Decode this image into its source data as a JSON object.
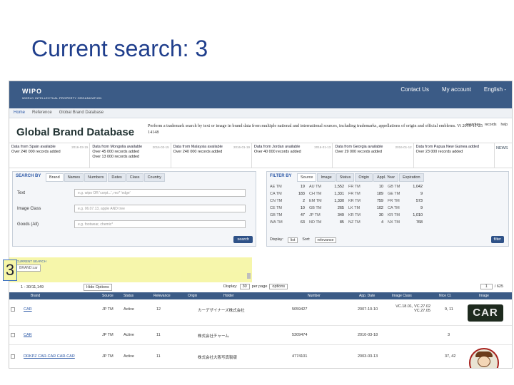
{
  "slide": {
    "title": "Current search: 3",
    "marker": "3"
  },
  "header": {
    "logo": "WIPO",
    "logo_sub": "WORLD INTELLECTUAL PROPERTY ORGANIZATION",
    "nav": [
      "Contact Us",
      "My account",
      "English -"
    ]
  },
  "breadcrumb": [
    "Home",
    "Reference",
    "Global Brand Database"
  ],
  "gbd": {
    "title": "Global Brand Database",
    "description": "Perform a trademark search by text or image in brand data from multiple national and international sources, including trademarks, appellations of origin and official emblems. Vi 2016-11-25 14148",
    "options": [
      "searches",
      "records",
      "help"
    ]
  },
  "news": {
    "items": [
      {
        "title": "Data from Spain available",
        "body": "Over 240 000 records added",
        "date": "2016-03-15"
      },
      {
        "title": "Data from Mongolia available",
        "body": "Over 45 000 records added\nOver 13 000 records added",
        "date": "2016-03-15"
      },
      {
        "title": "Data from Malaysia available",
        "body": "Over 240 000 records added",
        "date": "2016-01-19"
      },
      {
        "title": "Data from Jordan available",
        "body": "Over 40 000 records added",
        "date": "2016-01-13"
      },
      {
        "title": "Data from Georgia available",
        "body": "Over 29 000 records added",
        "date": "2016-01-12"
      },
      {
        "title": "Data from Papua New Guinea added",
        "body": "Over 23 000 records added",
        "date": ""
      }
    ],
    "button": "NEWS"
  },
  "search": {
    "title": "SEARCH BY",
    "tabs": [
      "Brand",
      "Names",
      "Numbers",
      "Dates",
      "Class",
      "Country"
    ],
    "rows": [
      {
        "label": "Text",
        "placeholder": "e.g. wipo OR 'corpt...', mo* 'edge'"
      },
      {
        "label": "Image Class",
        "placeholder": "e.g. 06.07.13, apple AND tree"
      },
      {
        "label": "Goods (All)",
        "placeholder": "e.g. footwear, chemic*"
      }
    ],
    "button": "search"
  },
  "filter": {
    "title": "FILTER BY",
    "tabs": [
      "Source",
      "Image",
      "Status",
      "Origin",
      "Appl. Year",
      "Expiration"
    ],
    "rows": [
      [
        [
          "AE TM",
          "19"
        ],
        [
          "AU TM",
          "1,552"
        ],
        [
          "FR TM",
          "10"
        ],
        [
          "GB TM",
          "1,042"
        ]
      ],
      [
        [
          "CA TM",
          "183"
        ],
        [
          "CH TM",
          "1,331"
        ],
        [
          "FR TM",
          "189"
        ],
        [
          "GE TM",
          "9"
        ]
      ],
      [
        [
          "CN TM",
          "2"
        ],
        [
          "EM TM",
          "1,330"
        ],
        [
          "KR TM",
          "759"
        ],
        [
          "FR TM",
          "573"
        ]
      ],
      [
        [
          "CE TM",
          "10"
        ],
        [
          "GB TM",
          "265"
        ],
        [
          "LK TM",
          "102"
        ],
        [
          "CA TM",
          "9"
        ]
      ],
      [
        [
          "GB TM",
          "47"
        ],
        [
          "JP TM",
          "349"
        ],
        [
          "KR TM",
          "30"
        ],
        [
          "KR TM",
          "1,010"
        ]
      ],
      [
        [
          "WA TM",
          "63"
        ],
        [
          "ND TM",
          "85"
        ],
        [
          "NZ TM",
          "4"
        ],
        [
          "NX TM",
          "768"
        ]
      ]
    ],
    "display_label": "Display:",
    "display_value": "list",
    "sort_label": "Sort:",
    "sort_value": "relevance",
    "button": "filter"
  },
  "current": {
    "label": "CURRENT SEARCH",
    "tag": "BRAND:car"
  },
  "results": {
    "count": "1 - 30/11,149",
    "options": "Hide Options",
    "display_label": "Display:",
    "per_page_value": "30",
    "per_page_label": "per page",
    "options2": "options",
    "page": "1",
    "pages": "/ 625",
    "columns": [
      "Brand",
      "Source",
      "Status",
      "Relevance",
      "Origin",
      "Holder",
      "Number",
      "App. Date",
      "Image Class",
      "Nice Cl.",
      "Image"
    ],
    "rows": [
      {
        "brand": "CAR",
        "source": "JP TM",
        "status": "Active",
        "rel": "12",
        "holder": "カーデザイナーズ株式会社",
        "number": "5059427",
        "date": "2007-10-10",
        "img": "VC.18.01, VC.27.02\nVC.27.05",
        "nice": "9, 11",
        "pic": "CAR"
      },
      {
        "brand": "CAR",
        "source": "JP TM",
        "status": "Active",
        "rel": "11",
        "holder": "株式会社チャーム",
        "number": "5309474",
        "date": "2010-03-18",
        "img": "",
        "nice": "3",
        "pic": ""
      },
      {
        "brand": "DRKPZ CAR-CAR CAR-CAR",
        "source": "JP TM",
        "status": "Active",
        "rel": "11",
        "holder": "株式会社大阪写真製版",
        "number": "4774101",
        "date": "2003-03-13",
        "img": "",
        "nice": "37, 42",
        "pic": "mascot"
      }
    ]
  }
}
